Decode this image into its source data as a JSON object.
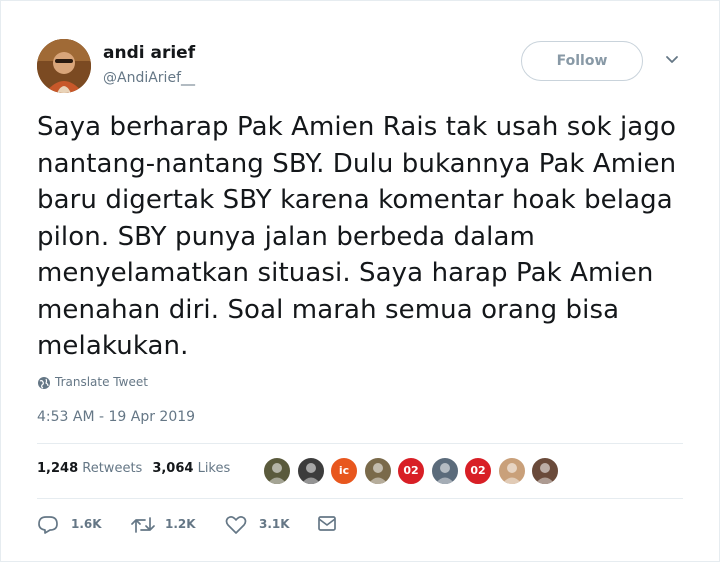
{
  "user": {
    "name": "andi arief",
    "handle": "@AndiArief__",
    "avatar_icon": "user-avatar"
  },
  "follow_button": {
    "label": "Follow"
  },
  "menu": {
    "icon": "chevron-down-icon"
  },
  "tweet": {
    "text": "Saya berharap Pak Amien Rais tak usah sok jago nantang-nantang SBY.  Dulu bukannya Pak Amien baru digertak SBY karena komentar hoak belaga pilon. SBY punya jalan berbeda dalam menyelamatkan situasi. Saya harap Pak Amien menahan diri. Soal marah semua orang bisa melakukan.",
    "translate_label": "Translate Tweet",
    "timestamp": "4:53 AM - 19 Apr 2019"
  },
  "stats": {
    "retweets_count": "1,248",
    "retweets_label": "Retweets",
    "likes_count": "3,064",
    "likes_label": "Likes"
  },
  "liker_avatars": [
    {
      "icon": "liker-avatar-1",
      "color": "#5a5a3c"
    },
    {
      "icon": "liker-avatar-2",
      "color": "#3c3c3c"
    },
    {
      "icon": "liker-avatar-3",
      "color": "#e8571e",
      "text": "ic"
    },
    {
      "icon": "liker-avatar-4",
      "color": "#7a6a4a"
    },
    {
      "icon": "liker-avatar-5",
      "color": "#d81f26",
      "text": "02"
    },
    {
      "icon": "liker-avatar-6",
      "color": "#5b6b7b"
    },
    {
      "icon": "liker-avatar-7",
      "color": "#d81f26",
      "text": "02"
    },
    {
      "icon": "liker-avatar-8",
      "color": "#c9a07a"
    },
    {
      "icon": "liker-avatar-9",
      "color": "#6a4a3a"
    }
  ],
  "actions": {
    "reply_count": "1.6K",
    "retweet_count": "1.2K",
    "like_count": "3.1K"
  },
  "colors": {
    "text": "#14171a",
    "secondary": "#657786",
    "border": "#e6ecf0"
  }
}
